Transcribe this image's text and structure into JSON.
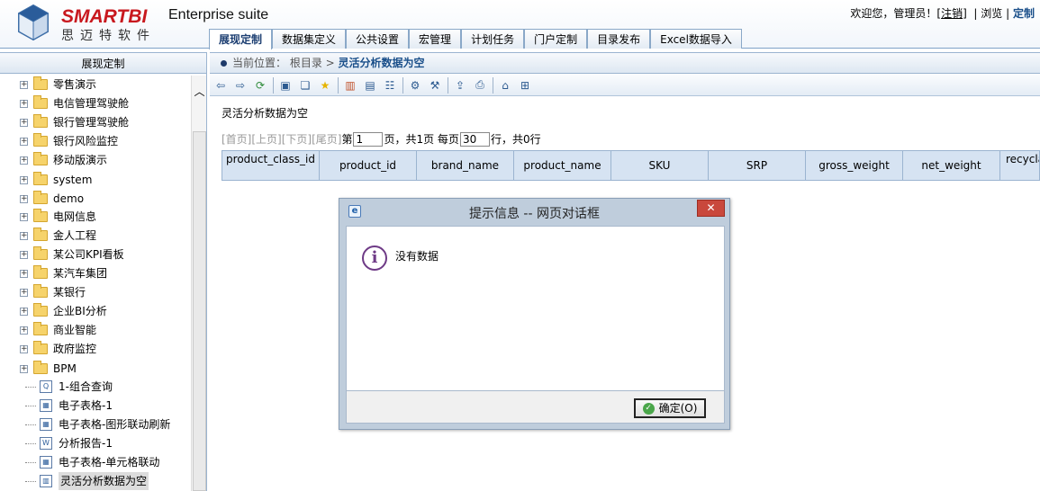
{
  "header": {
    "brand": "SMARTBI",
    "brand_cn": "思迈特软件",
    "suite": "Enterprise suite",
    "welcome": "欢迎您，管理员！[",
    "logout": "注销",
    "welcome_end": "]",
    "browse": "浏览",
    "customize": "定制"
  },
  "tabs": [
    "展现定制",
    "数据集定义",
    "公共设置",
    "宏管理",
    "计划任务",
    "门户定制",
    "目录发布",
    "Excel数据导入"
  ],
  "sidebar": {
    "title": "展现定制",
    "folders": [
      "零售演示",
      "电信管理驾驶舱",
      "银行管理驾驶舱",
      "银行风险监控",
      "移动版演示",
      "system",
      "demo",
      "电网信息",
      "金人工程",
      "某公司KPI看板",
      "某汽车集团",
      "某银行",
      "企业BI分析",
      "商业智能",
      "政府监控",
      "BPM"
    ],
    "leaves": [
      {
        "label": "1-组合查询",
        "icon": "query-icon"
      },
      {
        "label": "电子表格-1",
        "icon": "spreadsheet-icon"
      },
      {
        "label": "电子表格-图形联动刷新",
        "icon": "spreadsheet-icon"
      },
      {
        "label": "分析报告-1",
        "icon": "word-report-icon"
      },
      {
        "label": "电子表格-单元格联动",
        "icon": "spreadsheet-icon"
      },
      {
        "label": "灵活分析数据为空",
        "icon": "analysis-icon"
      }
    ]
  },
  "breadcrumb": {
    "prefix": "当前位置：",
    "root": "根目录 >",
    "current": "灵活分析数据为空"
  },
  "content": {
    "title": "灵活分析数据为空"
  },
  "pager": {
    "nav": "[首页][上页][下页][尾页]",
    "page_prefix": "第",
    "page_value": "1",
    "page_suffix": "页，共1页 每页",
    "rows_value": "30",
    "rows_suffix": "行，共0行"
  },
  "columns": [
    "product_class_id",
    "product_id",
    "brand_name",
    "product_name",
    "SKU",
    "SRP",
    "gross_weight",
    "net_weight",
    "recyclable_package"
  ],
  "dialog": {
    "title": "提示信息 -- 网页对话框",
    "message": "没有数据",
    "ok": "确定(O)",
    "close": "✕"
  }
}
